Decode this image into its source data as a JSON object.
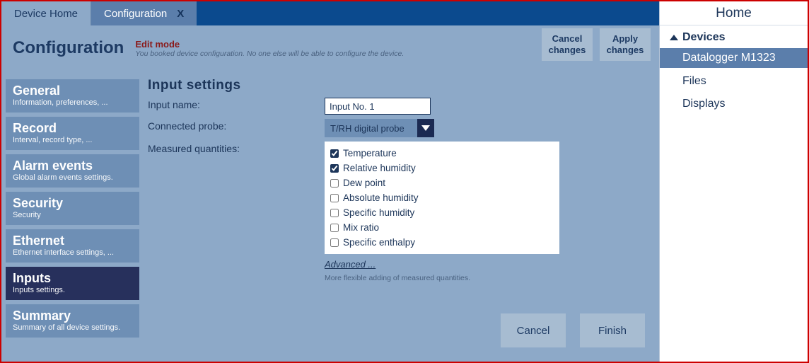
{
  "tabs": {
    "home": "Device Home",
    "config": "Configuration",
    "close_x": "X"
  },
  "header": {
    "title": "Configuration",
    "edit_mode_title": "Edit mode",
    "edit_mode_sub": "You booked device configuration. No one else will be able to configure the device.",
    "cancel_btn": "Cancel\nchanges",
    "apply_btn": "Apply\nchanges"
  },
  "sidebar": [
    {
      "title": "General",
      "sub": "Information, preferences, ..."
    },
    {
      "title": "Record",
      "sub": "Interval, record type, ..."
    },
    {
      "title": "Alarm events",
      "sub": "Global alarm events settings."
    },
    {
      "title": "Security",
      "sub": "Security"
    },
    {
      "title": "Ethernet",
      "sub": "Ethernet interface settings, ..."
    },
    {
      "title": "Inputs",
      "sub": "Inputs settings."
    },
    {
      "title": "Summary",
      "sub": "Summary of all device settings."
    }
  ],
  "sidebar_active_index": 5,
  "panel": {
    "title": "Input  settings",
    "input_name_label": "Input name:",
    "input_name_value": "Input No. 1",
    "probe_label": "Connected probe:",
    "probe_value": "T/RH digital probe",
    "qty_label": "Measured quantities:",
    "quantities": [
      {
        "label": "Temperature",
        "checked": true
      },
      {
        "label": "Relative humidity",
        "checked": true
      },
      {
        "label": "Dew point",
        "checked": false
      },
      {
        "label": "Absolute humidity",
        "checked": false
      },
      {
        "label": "Specific humidity",
        "checked": false
      },
      {
        "label": "Mix ratio",
        "checked": false
      },
      {
        "label": "Specific enthalpy",
        "checked": false
      }
    ],
    "advanced_link": "Advanced ...",
    "advanced_sub": "More flexible adding of measured quantities.",
    "cancel_btn": "Cancel",
    "finish_btn": "Finish"
  },
  "right": {
    "home": "Home",
    "devices": "Devices",
    "selected_device": "Datalogger M1323",
    "files": "Files",
    "displays": "Displays"
  }
}
